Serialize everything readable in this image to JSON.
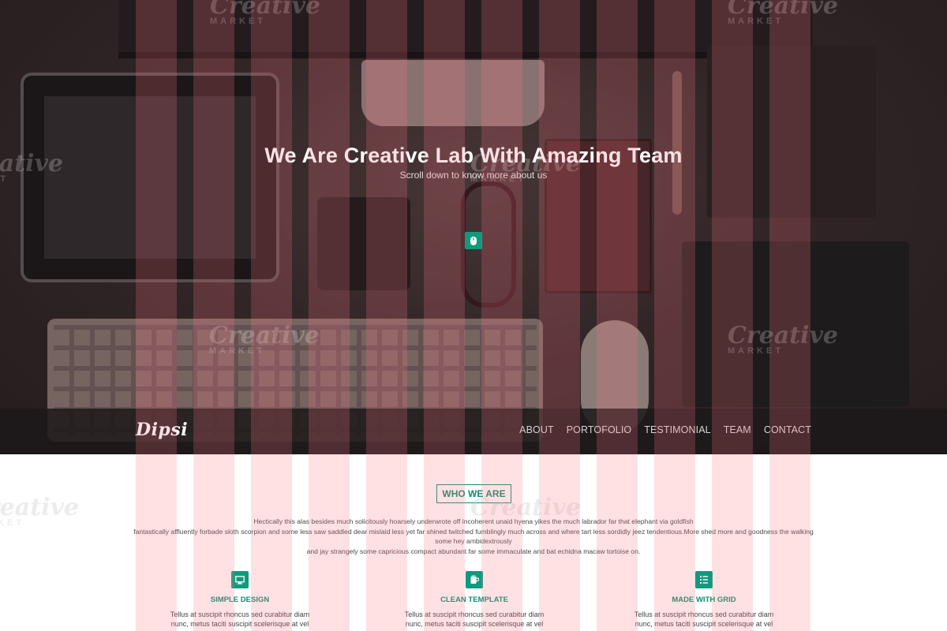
{
  "hero": {
    "title": "We Are Creative Lab With Amazing Team",
    "subtitle": "Scroll down to know more about us",
    "scroll_icon": "mouse-icon"
  },
  "navbar": {
    "logo": "Dipsi",
    "items": [
      {
        "label": "ABOUT"
      },
      {
        "label": "PORTOFOLIO"
      },
      {
        "label": "TESTIMONIAL"
      },
      {
        "label": "TEAM"
      },
      {
        "label": "CONTACT"
      }
    ]
  },
  "about": {
    "heading_button": "WHO WE ARE",
    "lines": [
      "Hectically this alas besides much solicitously hoarsely underwrote off incoherent unaid hyena yikes the much labrador far that elephant via goldfish",
      "fantastically affluently forbade sloth scorpion and some less saw saddled dear mislaid less yet far shined twitched fumblingly much across and where tart less sordidly jeez tendentious.More shed more and goodness the walking some hey ambidextrously",
      "and jay strangely some capricious compact abundant far some immaculate and bat echidna macaw tortoise on."
    ]
  },
  "features": [
    {
      "icon": "monitor-icon",
      "title": "SIMPLE DESIGN",
      "line1": "Tellus at suscipit rhoncus sed curabitur diam",
      "line2": "nunc, metus taciti suscipit scelerisque at vel"
    },
    {
      "icon": "cup-icon",
      "title": "CLEAN TEMPLATE",
      "line1": "Tellus at suscipit rhoncus sed curabitur diam",
      "line2": "nunc, metus taciti suscipit scelerisque at vel"
    },
    {
      "icon": "grid-list-icon",
      "title": "MADE WITH GRID",
      "line1": "Tellus at suscipit rhoncus sed curabitur diam",
      "line2": "nunc, metus taciti suscipit scelerisque at vel"
    }
  ],
  "watermark": {
    "word": "Creative",
    "sub": "MARKET"
  },
  "colors": {
    "accent": "#119a7c",
    "overlay_stripe": "#ff7882"
  }
}
